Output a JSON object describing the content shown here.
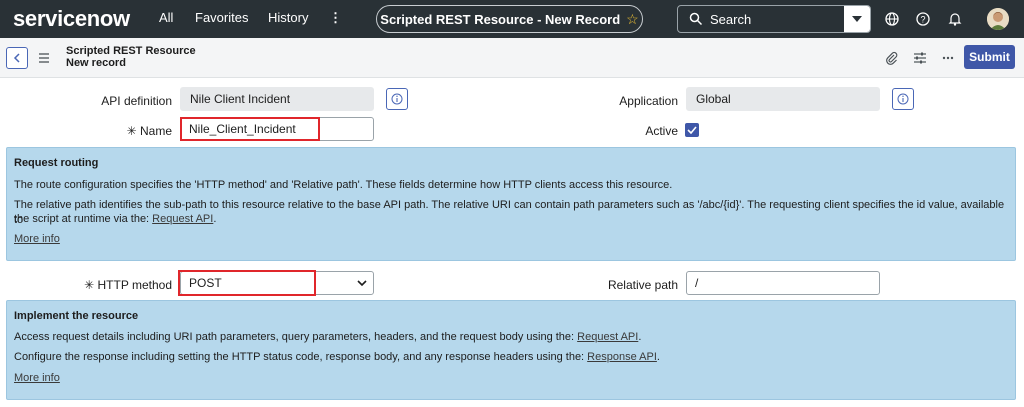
{
  "nav": {
    "logo": "servicenow",
    "all": "All",
    "favorites": "Favorites",
    "history": "History",
    "more": "⋮",
    "context_title": "Scripted REST Resource - New Record",
    "search_placeholder": "Search"
  },
  "header": {
    "title_line1": "Scripted REST Resource",
    "title_line2": "New record",
    "submit_label": "Submit"
  },
  "form": {
    "api_definition_label": "API definition",
    "api_definition_value": "Nile Client Incident",
    "application_label": "Application",
    "application_value": "Global",
    "name_label": "Name",
    "name_value": "Nile_Client_Incident",
    "active_label": "Active",
    "http_method_label": "HTTP method",
    "http_method_value": "POST",
    "relative_path_label": "Relative path",
    "relative_path_value": "/",
    "required_mark": "✳"
  },
  "routing": {
    "title": "Request routing",
    "p1": "The route configuration specifies the 'HTTP method' and 'Relative path'. These fields determine how HTTP clients access this resource.",
    "p2a": "The relative path identifies the sub-path to this resource relative to the base API path. The relative URI can contain path parameters such as '/abc/{id}'. The requesting client specifies the id value, available to",
    "p2b": "the script at runtime via the: ",
    "p2_link": "Request API",
    "p2_end": ".",
    "more": "More info"
  },
  "implement": {
    "title": "Implement the resource",
    "p1": "Access request details including URI path parameters, query parameters, headers, and the request body using the: ",
    "p1_link": "Request API",
    "p1_end": ".",
    "p2": "Configure the response including setting the HTTP status code, response body, and any response headers using the: ",
    "p2_link": "Response API",
    "p2_end": ".",
    "more": "More info"
  },
  "colors": {
    "nav_bg": "#293136",
    "accent": "#3f57a8",
    "panel_bg": "#b6d8ec",
    "highlight": "#e0262b"
  }
}
